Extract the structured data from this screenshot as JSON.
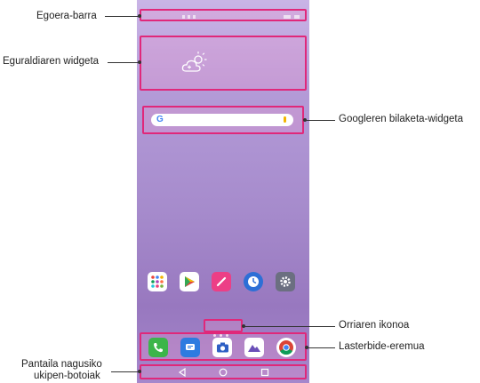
{
  "labels": {
    "status_bar": "Egoera-barra",
    "weather_widget": "Eguraldiaren widgeta",
    "google_search": "Googleren bilaketa-widgeta",
    "page_icon": "Orriaren ikonoa",
    "quick_access": "Lasterbide-eremua",
    "nav_buttons_line1": "Pantaila nagusiko",
    "nav_buttons_line2": "ukipen-botoiak"
  },
  "search": {
    "logo": "G"
  },
  "icons": {
    "weather": "cloud-sun-icon",
    "apps": [
      "app-drawer-icon",
      "play-store-icon",
      "qslide-pen-icon",
      "clock-icon",
      "settings-icon"
    ],
    "dock": [
      "phone-icon",
      "messages-icon",
      "camera-icon",
      "gallery-icon",
      "chrome-icon"
    ],
    "nav": [
      "back-icon",
      "home-icon",
      "recents-icon"
    ]
  },
  "colors": {
    "highlight": "#e0287a",
    "wallpaper_top": "#c9b4e6",
    "wallpaper_bottom": "#9878bf"
  }
}
